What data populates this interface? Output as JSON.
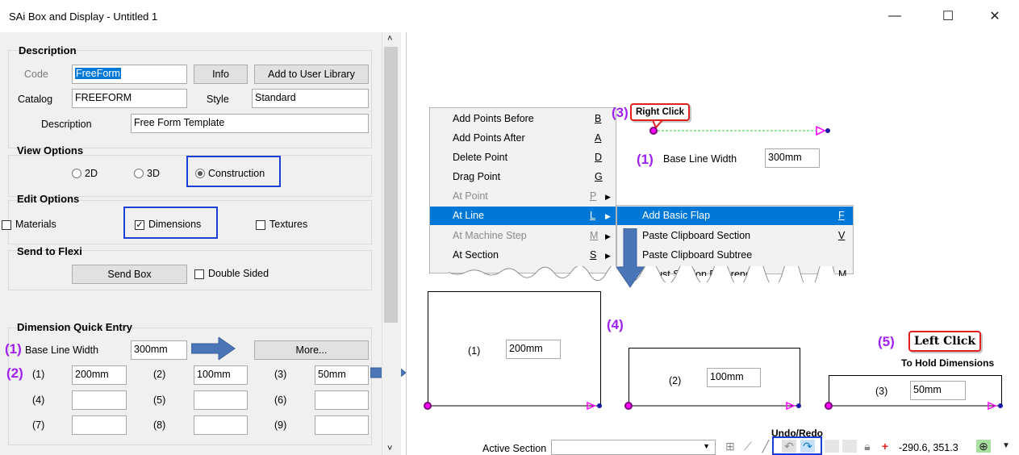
{
  "window": {
    "title": "SAi Box and Display - Untitled 1",
    "minimize_glyph": "—",
    "maximize_glyph": "☐",
    "close_glyph": "✕"
  },
  "description": {
    "title": "Description",
    "code_label": "Code",
    "code_value": "FreeForm",
    "info_button": "Info",
    "add_library_button": "Add to User Library",
    "catalog_label": "Catalog",
    "catalog_value": "FREEFORM",
    "style_label": "Style",
    "style_value": "Standard",
    "description_label": "Description",
    "description_value": "Free Form Template"
  },
  "view_options": {
    "title": "View Options",
    "options": [
      "2D",
      "3D",
      "Construction"
    ],
    "selected": "Construction"
  },
  "edit_options": {
    "title": "Edit Options",
    "materials": "Materials",
    "dimensions": "Dimensions",
    "textures": "Textures"
  },
  "send_to_flexi": {
    "title": "Send to Flexi",
    "send_box_button": "Send Box",
    "double_sided": "Double Sided"
  },
  "quick_entry": {
    "title": "Dimension Quick Entry",
    "step1": "(1)",
    "step2": "(2)",
    "base_line_label": "Base Line Width",
    "base_line_value": "300mm",
    "more_button": "More...",
    "labels": [
      "(1)",
      "(2)",
      "(3)",
      "(4)",
      "(5)",
      "(6)",
      "(7)",
      "(8)",
      "(9)"
    ],
    "values": [
      "200mm",
      "100mm",
      "50mm",
      "",
      "",
      "",
      "",
      "",
      ""
    ]
  },
  "context_menu": {
    "items": [
      {
        "label": "Add Points Before",
        "key": "B"
      },
      {
        "label": "Add Points After",
        "key": "A"
      },
      {
        "label": "Delete Point",
        "key": "D"
      },
      {
        "label": "Drag Point",
        "key": "G"
      },
      {
        "label": "At Point",
        "key": "P"
      },
      {
        "label": "At Line",
        "key": "L"
      },
      {
        "label": "At Machine Step",
        "key": "M"
      },
      {
        "label": "At Section",
        "key": "S"
      }
    ],
    "submenu": [
      {
        "label": "Add Basic Flap",
        "key": "F"
      },
      {
        "label": "Paste Clipboard Section",
        "key": "V"
      },
      {
        "label": "Paste Clipboard Subtree",
        "key": ""
      },
      {
        "label": "Adjust Section Reference",
        "key": "M"
      }
    ]
  },
  "annotations": {
    "step3": "(3)",
    "right_click": "Right Click",
    "step1": "(1)",
    "base_line_label": "Base Line Width",
    "base_line_value": "300mm",
    "step4": "(4)",
    "step5": "(5)",
    "left_click": "Left Click",
    "hold_dims": "To Hold Dimensions"
  },
  "canvas_boxes": [
    {
      "label": "(1)",
      "value": "200mm"
    },
    {
      "label": "(2)",
      "value": "100mm"
    },
    {
      "label": "(3)",
      "value": "50mm"
    }
  ],
  "status": {
    "active_section_label": "Active Section",
    "undo_redo_label": "Undo/Redo",
    "coords": "-290.6, 351.3"
  },
  "colors": {
    "accent_blue": "#0078d7",
    "annotation_purple": "#a020f0",
    "highlight_box": "#1a3fd6",
    "callout_red": "#e12020",
    "arrow_blue": "#4a76b8",
    "point_magenta": "#ff00ff"
  }
}
